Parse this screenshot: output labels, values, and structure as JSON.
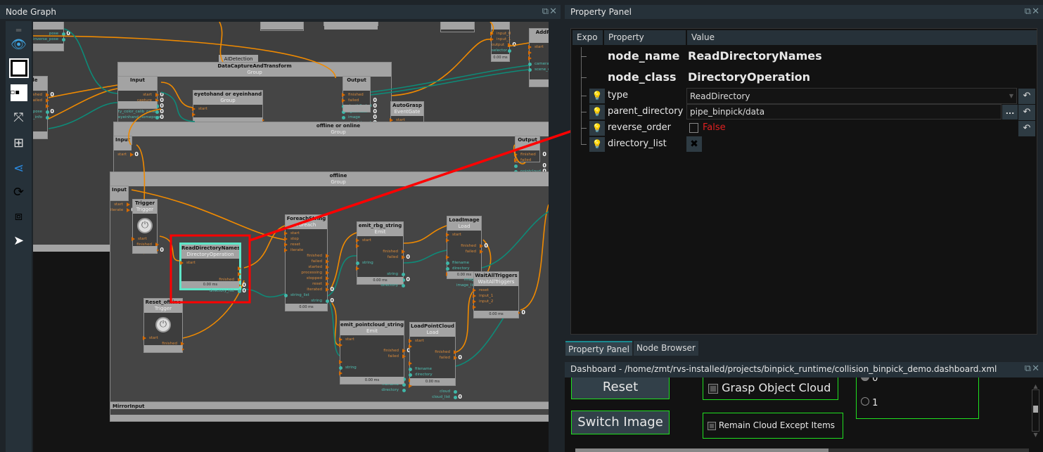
{
  "node_graph": {
    "title": "Node Graph",
    "toolbar": [
      "menu-handle",
      "eye-icon",
      "link-nodes-icon",
      "scatter-icon",
      "collapse-icon",
      "layout-icon",
      "share-icon",
      "refresh-icon",
      "screenshot-icon",
      "cursor-icon"
    ],
    "groups": {
      "dcat": {
        "title": "DataCaptureAndTransform",
        "sub": "Group"
      },
      "ooo": {
        "title": "offline or online",
        "sub": "Group"
      },
      "offline": {
        "title": "offline",
        "sub": "Group"
      },
      "ai_tab": "AIDetection",
      "mirror": "MirrorInput"
    },
    "nodes": {
      "pose_node": {
        "title": "",
        "sub": "",
        "ports": [
          {
            "n": "pose",
            "s": "out",
            "k": "data",
            "c": "0"
          },
          {
            "n": "inverse_pose",
            "s": "out",
            "k": "data"
          }
        ]
      },
      "ofile": {
        "title": "oFile",
        "sub": "",
        "ports": [
          {
            "n": "finished",
            "s": "out",
            "k": "exec",
            "c": "0"
          },
          {
            "n": "failed",
            "s": "out",
            "k": "exec"
          },
          {
            "n": "",
            "s": "out",
            "k": "exec"
          },
          {
            "n": "ic_pose",
            "s": "out",
            "k": "data",
            "c": "0"
          },
          {
            "n": "lib_info",
            "s": "out",
            "k": "data"
          }
        ]
      },
      "top1": {
        "title": "",
        "sub": "",
        "ports": []
      },
      "top2": {
        "title": "",
        "sub": "",
        "ports": []
      },
      "top3": {
        "title": "",
        "sub": "",
        "ports": []
      },
      "dcat_input": {
        "title": "Input",
        "sub": "",
        "ports": [
          {
            "n": "start",
            "s": "out",
            "k": "exec",
            "c": "0"
          },
          {
            "n": "capture",
            "s": "out",
            "k": "exec",
            "c": "0"
          },
          {
            "n": "handeye_calib_result",
            "s": "out",
            "k": "data",
            "c": "0"
          },
          {
            "n": "ty_color_calib_pose",
            "s": "out",
            "k": "data",
            "c": "0"
          },
          {
            "n": "eyeinhand_homepose",
            "s": "out",
            "k": "data",
            "c": "0"
          }
        ]
      },
      "eyetohand": {
        "title": "eyetohand or eyeinhand",
        "sub": "Group",
        "ports": [
          {
            "n": "start",
            "s": "in",
            "k": "exec"
          },
          {
            "n": "",
            "s": "in",
            "k": "exec"
          },
          {
            "n": "finished",
            "s": "out",
            "k": "exec"
          },
          {
            "n": "failed",
            "s": "out",
            "k": "exec"
          }
        ]
      },
      "dcat_output": {
        "title": "Output",
        "sub": "",
        "ports": [
          {
            "n": "finished",
            "s": "in",
            "k": "exec"
          },
          {
            "n": "failed",
            "s": "in",
            "k": "exec",
            "c": "0"
          },
          {
            "n": "depth2robot",
            "s": "in",
            "k": "data",
            "c": "0"
          },
          {
            "n": "rgb2robot",
            "s": "in",
            "k": "data",
            "c": "0"
          },
          {
            "n": "image",
            "s": "in",
            "k": "data",
            "c": "0"
          },
          {
            "n": "cloud_in_robot",
            "s": "in",
            "k": "data",
            "c": "0"
          }
        ]
      },
      "autograsp": {
        "title": "AutoGrasp",
        "sub": "EventGate",
        "ports": [
          {
            "n": "start",
            "s": "in",
            "k": "exec"
          }
        ]
      },
      "or_node": {
        "title": "",
        "sub": "Or",
        "ports": [
          {
            "n": "input_0",
            "s": "in",
            "k": "exec"
          },
          {
            "n": "input_1",
            "s": "in",
            "k": "exec"
          },
          {
            "n": "output",
            "s": "out",
            "k": "exec",
            "c": "0"
          },
          {
            "n": "selector",
            "s": "out",
            "k": "data"
          }
        ],
        "time": "0.00 ms"
      },
      "addre": {
        "title": "AddRe",
        "sub": "",
        "ports": [
          {
            "n": "start",
            "s": "in",
            "k": "exec"
          },
          {
            "n": "",
            "s": "in",
            "k": "exec"
          },
          {
            "n": "",
            "s": "in",
            "k": "exec"
          },
          {
            "n": "camera_po",
            "s": "in",
            "k": "data"
          },
          {
            "n": "scene_clou",
            "s": "in",
            "k": "data"
          }
        ]
      },
      "ooo_input": {
        "title": "Input",
        "sub": "",
        "ports": [
          {
            "n": "start",
            "s": "out",
            "k": "exec",
            "c": "0"
          }
        ]
      },
      "ooo_output": {
        "title": "Output",
        "sub": "",
        "ports": [
          {
            "n": "finished",
            "s": "in",
            "k": "exec",
            "c": "0"
          },
          {
            "n": "failed",
            "s": "in",
            "k": "exec"
          },
          {
            "n": "",
            "s": "in",
            "k": "data",
            "c": "0"
          },
          {
            "n": "pointcloud",
            "s": "in",
            "k": "data",
            "c": "0"
          }
        ]
      },
      "off_input": {
        "title": "Input",
        "sub": "",
        "ports": [
          {
            "n": "start",
            "s": "out",
            "k": "exec"
          },
          {
            "n": "iterate",
            "s": "out",
            "k": "exec",
            "c": "0"
          }
        ]
      },
      "trigger": {
        "title": "Trigger",
        "sub": "Trigger",
        "icon": "power-icon",
        "ports": [
          {
            "n": "start",
            "s": "in",
            "k": "exec"
          },
          {
            "n": "finished",
            "s": "out",
            "k": "exec"
          },
          {
            "n": "failed",
            "s": "out",
            "k": "exec",
            "c": "0"
          }
        ]
      },
      "readdir": {
        "title": "ReadDirectoryNames",
        "sub": "DirectoryOperation",
        "selected": true,
        "ports": [
          {
            "n": "start",
            "s": "in",
            "k": "exec"
          },
          {
            "n": "",
            "s": "out",
            "k": "exec"
          },
          {
            "n": "",
            "s": "out",
            "k": "exec"
          },
          {
            "n": "finished",
            "s": "out",
            "k": "exec"
          },
          {
            "n": "failed",
            "s": "out",
            "k": "exec",
            "c": "0"
          },
          {
            "n": "directory_list",
            "s": "out",
            "k": "data",
            "c": "0"
          }
        ],
        "time": "0.00 ms"
      },
      "reset_offline": {
        "title": "Reset_offline",
        "sub": "Trigger",
        "icon": "power-icon",
        "ports": [
          {
            "n": "start",
            "s": "in",
            "k": "exec"
          },
          {
            "n": "finished",
            "s": "out",
            "k": "exec"
          },
          {
            "n": "failed",
            "s": "out",
            "k": "exec"
          }
        ]
      },
      "foreach": {
        "title": "ForeachString",
        "sub": "Foreach",
        "ports": [
          {
            "n": "start",
            "s": "in",
            "k": "exec"
          },
          {
            "n": "stop",
            "s": "in",
            "k": "exec"
          },
          {
            "n": "reset",
            "s": "in",
            "k": "exec"
          },
          {
            "n": "iterate",
            "s": "in",
            "k": "exec"
          },
          {
            "n": "finished",
            "s": "out",
            "k": "exec"
          },
          {
            "n": "failed",
            "s": "out",
            "k": "exec"
          },
          {
            "n": "started",
            "s": "out",
            "k": "exec"
          },
          {
            "n": "processing",
            "s": "out",
            "k": "exec"
          },
          {
            "n": "stopped",
            "s": "out",
            "k": "exec"
          },
          {
            "n": "reset",
            "s": "out",
            "k": "exec"
          },
          {
            "n": "iterated",
            "s": "out",
            "k": "exec",
            "c": "0"
          },
          {
            "n": "string_list",
            "s": "in",
            "k": "data"
          },
          {
            "n": "string",
            "s": "out",
            "k": "data",
            "c": "0"
          }
        ],
        "time": "0.00 ms"
      },
      "emit_rbg": {
        "title": "emit_rbg_string",
        "sub": "Emit",
        "ports": [
          {
            "n": "start",
            "s": "in",
            "k": "exec"
          },
          {
            "n": "",
            "s": "in",
            "k": "exec"
          },
          {
            "n": "finished",
            "s": "out",
            "k": "exec"
          },
          {
            "n": "failed",
            "s": "out",
            "k": "exec",
            "c": "0"
          },
          {
            "n": "string",
            "s": "in",
            "k": "data"
          },
          {
            "n": "",
            "s": "in",
            "k": "exec"
          },
          {
            "n": "string",
            "s": "out",
            "k": "data"
          },
          {
            "n": "filename",
            "s": "out",
            "k": "data",
            "c": "0"
          },
          {
            "n": "directory",
            "s": "out",
            "k": "data"
          }
        ],
        "time": "0.00 ms"
      },
      "loadimage": {
        "title": "LoadImage",
        "sub": "Load",
        "ports": [
          {
            "n": "start",
            "s": "in",
            "k": "exec"
          },
          {
            "n": "",
            "s": "in",
            "k": "exec"
          },
          {
            "n": "finished",
            "s": "out",
            "k": "exec",
            "c": "0"
          },
          {
            "n": "failed",
            "s": "out",
            "k": "exec"
          },
          {
            "n": "",
            "s": "in",
            "k": "exec"
          },
          {
            "n": "filename",
            "s": "in",
            "k": "data"
          },
          {
            "n": "directory",
            "s": "in",
            "k": "data"
          },
          {
            "n": "",
            "s": "in",
            "k": "exec"
          },
          {
            "n": "image",
            "s": "out",
            "k": "data"
          },
          {
            "n": "image_list",
            "s": "out",
            "k": "data",
            "c": "0"
          }
        ],
        "time": "0.00 ms"
      },
      "waitall": {
        "title": "WaitAllTriggers",
        "sub": "WaitAllTriggers",
        "ports": [
          {
            "n": "reset",
            "s": "in",
            "k": "exec"
          },
          {
            "n": "input_1",
            "s": "in",
            "k": "exec"
          },
          {
            "n": "input_2",
            "s": "in",
            "k": "exec"
          },
          {
            "n": "",
            "s": "in",
            "k": "exec"
          },
          {
            "n": "finished",
            "s": "out",
            "k": "exec",
            "c": "0"
          }
        ],
        "time": "0.00 ms"
      },
      "emit_pc": {
        "title": "emit_pointcloud_string",
        "sub": "Emit",
        "ports": [
          {
            "n": "start",
            "s": "in",
            "k": "exec"
          },
          {
            "n": "",
            "s": "in",
            "k": "exec"
          },
          {
            "n": "finished",
            "s": "out",
            "k": "exec",
            "c": "0"
          },
          {
            "n": "failed",
            "s": "out",
            "k": "exec"
          },
          {
            "n": "",
            "s": "in",
            "k": "exec"
          },
          {
            "n": "string",
            "s": "in",
            "k": "data"
          },
          {
            "n": "",
            "s": "in",
            "k": "exec"
          },
          {
            "n": "string",
            "s": "out",
            "k": "data"
          },
          {
            "n": "filename",
            "s": "out",
            "k": "data"
          },
          {
            "n": "directory",
            "s": "out",
            "k": "data"
          }
        ],
        "time": "0.00 ms"
      },
      "loadpc": {
        "title": "LoadPointCloud",
        "sub": "Load",
        "ports": [
          {
            "n": "start",
            "s": "in",
            "k": "exec"
          },
          {
            "n": "",
            "s": "in",
            "k": "exec"
          },
          {
            "n": "finished",
            "s": "out",
            "k": "exec"
          },
          {
            "n": "failed",
            "s": "out",
            "k": "exec",
            "c": "0"
          },
          {
            "n": "",
            "s": "in",
            "k": "exec"
          },
          {
            "n": "filename",
            "s": "in",
            "k": "data"
          },
          {
            "n": "directory",
            "s": "in",
            "k": "data"
          },
          {
            "n": "",
            "s": "in",
            "k": "exec"
          },
          {
            "n": "",
            "s": "in",
            "k": "exec"
          },
          {
            "n": "cloud",
            "s": "out",
            "k": "data"
          },
          {
            "n": "cloud_list",
            "s": "out",
            "k": "data",
            "c": "0"
          }
        ],
        "time": "0.00 ms"
      }
    }
  },
  "property_panel": {
    "title": "Property Panel",
    "headers": {
      "expo": "Expo",
      "property": "Property",
      "value": "Value"
    },
    "node_name": {
      "label": "node_name",
      "value": "ReadDirectoryNames"
    },
    "node_class": {
      "label": "node_class",
      "value": "DirectoryOperation"
    },
    "type": {
      "label": "type",
      "value": "ReadDirectory"
    },
    "parent_directory": {
      "label": "parent_directory",
      "value": "pipe_binpick/data",
      "browse": "..."
    },
    "reverse_order": {
      "label": "reverse_order",
      "value": "False",
      "checked": false
    },
    "directory_list": {
      "label": "directory_list"
    },
    "tabs": [
      "Property Panel",
      "Node Browser"
    ],
    "active_tab": "Property Panel"
  },
  "dashboard": {
    "title": "Dashboard - /home/zmt/rvs-installed/projects/binpick_runtime/collision_binpick_demo.dashboard.xml",
    "reset": "Reset",
    "switch_image": "Switch Image",
    "grasp_object_cloud": "Grasp Object Cloud",
    "remain_cloud": "Remain Cloud Except Items",
    "radio_options": [
      "0",
      "1"
    ],
    "radio_selected": "0"
  },
  "colors": {
    "exec": "#d66a00",
    "data": "#3fb7a8",
    "selected": "#5fe6c8",
    "annotation": "#ff0000",
    "dashboard_border": "#20e020",
    "false_text": "#e02020"
  }
}
